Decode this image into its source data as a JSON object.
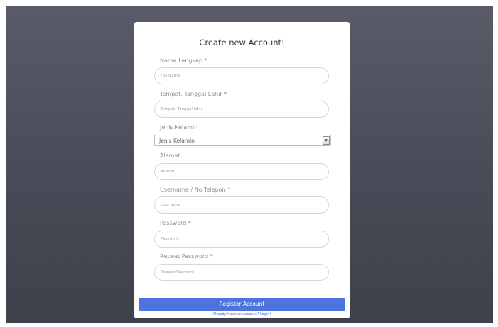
{
  "form": {
    "title": "Create new Account!",
    "fields": [
      {
        "label": "Nama Lengkap *",
        "placeholder": "Full Name"
      },
      {
        "label": "Tempat, Tanggal Lahir *",
        "placeholder": "Tempat, Tanggal lahir"
      },
      {
        "label": "Jenis Kelamin",
        "selected": "Jenis Kelamin"
      },
      {
        "label": "Alamat",
        "placeholder": "Alamat"
      },
      {
        "label": "Username / No Telepon *",
        "placeholder": "Username"
      },
      {
        "label": "Password *",
        "placeholder": "Password"
      },
      {
        "label": "Repeat Password *",
        "placeholder": "Repeat Password"
      }
    ],
    "register_label": "Register Account",
    "login_link": "Already have an account? Login!"
  },
  "colors": {
    "primary": "#4e73df",
    "background": "#4b4e5a"
  },
  "icons": {
    "select_arrow": "chevron-down-icon"
  }
}
